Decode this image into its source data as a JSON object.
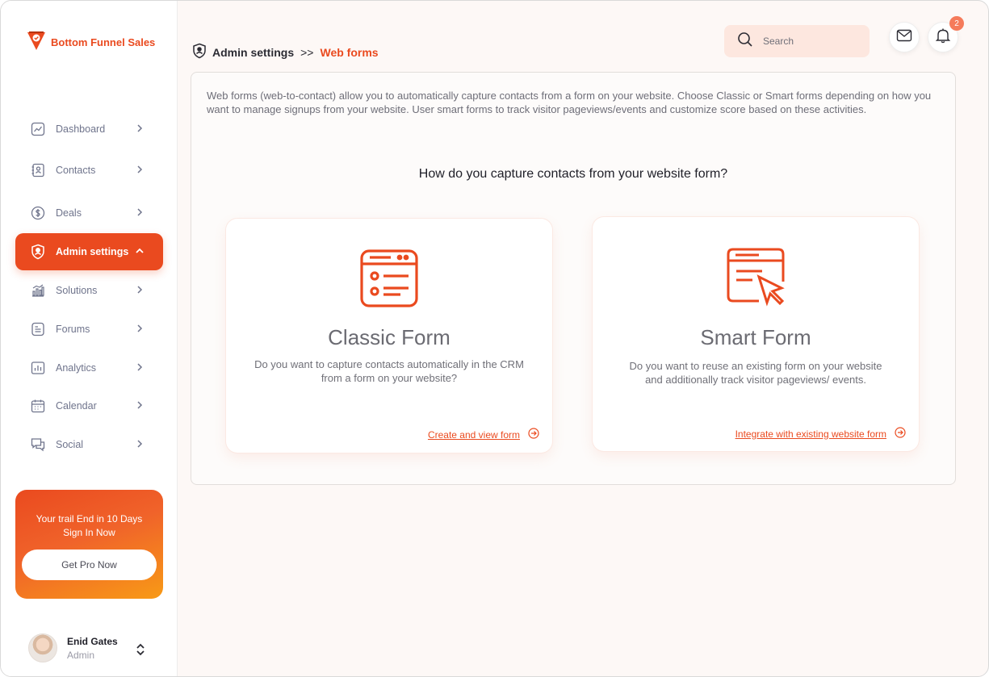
{
  "brand": {
    "name": "Bottom Funnel Sales",
    "color": "#ea4a1f"
  },
  "sidebar": {
    "items": [
      {
        "label": "Dashboard",
        "icon": "chart-line-icon"
      },
      {
        "label": "Contacts",
        "icon": "contacts-book-icon"
      },
      {
        "label": "Deals",
        "icon": "dollar-circle-icon"
      },
      {
        "label": "Admin settings",
        "icon": "shield-user-icon",
        "active": true
      },
      {
        "label": "Solutions",
        "icon": "bar-chart-icon"
      },
      {
        "label": "Forums",
        "icon": "document-icon"
      },
      {
        "label": "Analytics",
        "icon": "analytics-icon"
      },
      {
        "label": "Calendar",
        "icon": "calendar-icon"
      },
      {
        "label": "Social",
        "icon": "chat-bubbles-icon"
      }
    ],
    "promo": {
      "line1": "Your trail End in 10 Days",
      "line2": "Sign In Now",
      "button_label": "Get Pro Now"
    },
    "user": {
      "name": "Enid Gates",
      "role": "Admin"
    }
  },
  "header": {
    "breadcrumb": {
      "parent": "Admin settings",
      "separator": ">>",
      "current": "Web forms"
    },
    "search": {
      "placeholder": "Search",
      "value": ""
    },
    "notifications_count": "2"
  },
  "main": {
    "intro": "Web forms (web-to-contact) allow you to automatically capture contacts from a form on your website. Choose Classic or Smart forms depending on how you want to manage signups from your website. User smart forms to track visitor pageviews/events and customize score based on these activities.",
    "question": "How do you capture contacts from your website form?",
    "options": [
      {
        "title": "Classic Form",
        "description": "Do you want to capture contacts automatically in the CRM from a form on your website?",
        "link": "Create and view form",
        "icon": "form-list-icon"
      },
      {
        "title": "Smart Form",
        "description": "Do you want to reuse an existing form on your website and additionally track visitor pageviews/ events.",
        "link": "Integrate with existing website form",
        "icon": "browser-cursor-icon"
      }
    ]
  },
  "colors": {
    "accent": "#ea4a1f",
    "search_bg": "#fde7df",
    "page_bg": "#fdf8f6"
  }
}
